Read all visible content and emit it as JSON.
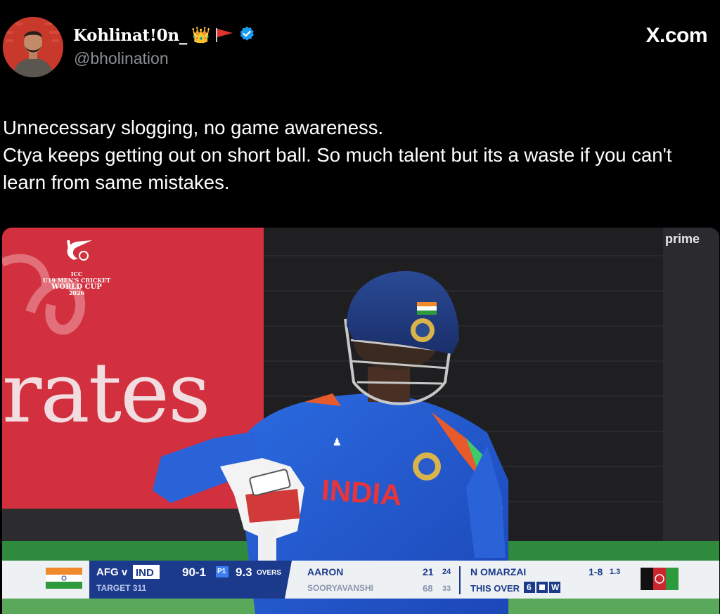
{
  "author": {
    "display_name": "Kohlinat!0n_",
    "name_emoji": "👑",
    "handle": "@bholination",
    "verified": true,
    "avatar": "avatar-photo"
  },
  "brand": "X.com",
  "tweet": {
    "lines": [
      "Unnecessary slogging, no game awareness.",
      "Ctya keeps getting out on short ball. So much talent but its a waste if you can't learn from same mistakes."
    ]
  },
  "media": {
    "watermark": "prime",
    "board_text": "rates",
    "event_logo_text": [
      "ICC",
      "U19 MEN'S CRICKET",
      "WORLD CUP",
      "2026"
    ],
    "jersey_text": "INDIA",
    "scorebar": {
      "team_a": "AFG v",
      "team_b": "IND",
      "score": "90-1",
      "powerplay": "P1",
      "overs": "9.3",
      "overs_label": "OVERS",
      "target": "TARGET 311",
      "batter1_name": "AARON",
      "batter1_runs": "21",
      "batter1_balls": "24",
      "batter2_name": "SOORYAVANSHI",
      "batter2_runs": "68",
      "batter2_balls": "33",
      "bowler_name": "N OMARZAI",
      "bowler_figures": "1-8",
      "bowler_overs": "1.3",
      "this_over_label": "THIS OVER",
      "this_over_balls": [
        "6",
        "•",
        "W"
      ]
    }
  }
}
